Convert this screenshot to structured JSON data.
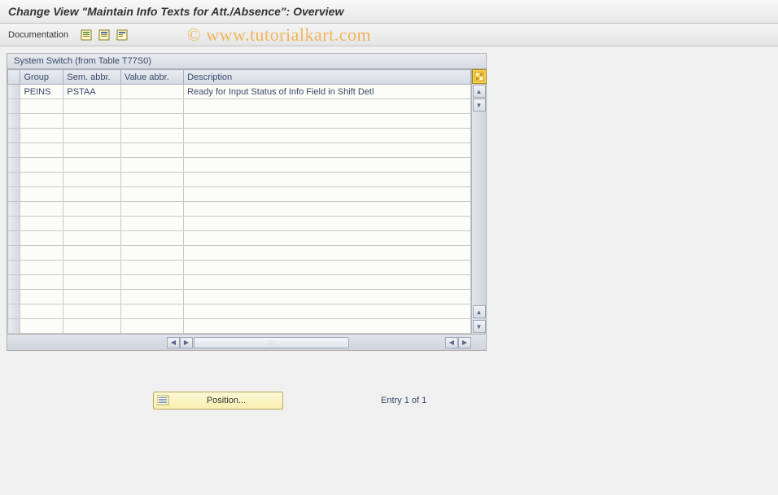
{
  "header": {
    "title": "Change View \"Maintain Info Texts for Att./Absence\": Overview"
  },
  "toolbar": {
    "documentation_label": "Documentation"
  },
  "watermark": "© www.tutorialkart.com",
  "table": {
    "title": "System Switch (from Table T77S0)",
    "columns": {
      "group": "Group",
      "sem_abbr": "Sem. abbr.",
      "value_abbr": "Value abbr.",
      "description": "Description"
    },
    "rows": [
      {
        "group": "PEINS",
        "sem_abbr": "PSTAA",
        "value_abbr": "",
        "description": "Ready for Input Status of Info Field in Shift Detl"
      }
    ]
  },
  "footer": {
    "position_label": "Position...",
    "entry_text": "Entry 1 of 1"
  }
}
